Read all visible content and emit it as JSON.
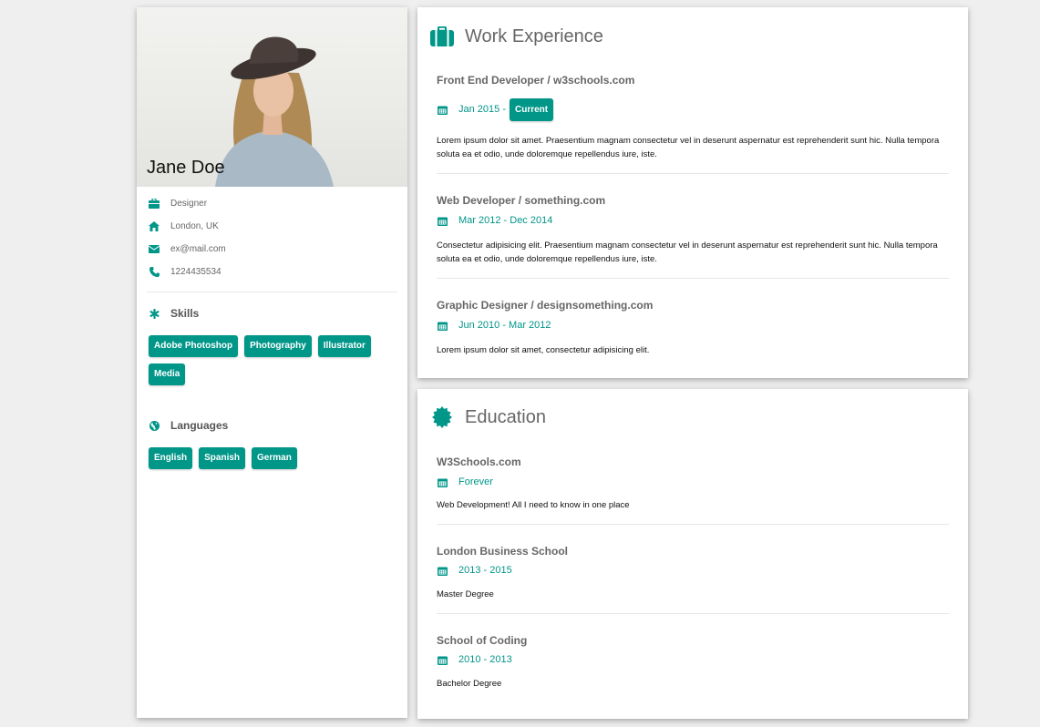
{
  "profile": {
    "name": "Jane Doe",
    "info": [
      {
        "icon": "briefcase-icon",
        "text": "Designer"
      },
      {
        "icon": "home-icon",
        "text": "London, UK"
      },
      {
        "icon": "envelope-icon",
        "text": "ex@mail.com"
      },
      {
        "icon": "phone-icon",
        "text": "1224435534"
      }
    ],
    "skills_label": "Skills",
    "skills": [
      "Adobe Photoshop",
      "Photography",
      "Illustrator",
      "Media"
    ],
    "languages_label": "Languages",
    "languages": [
      "English",
      "Spanish",
      "German"
    ]
  },
  "work": {
    "title": "Work Experience",
    "entries": [
      {
        "title": "Front End Developer / w3schools.com",
        "date": "Jan 2015 -",
        "badge": "Current",
        "desc": "Lorem ipsum dolor sit amet. Praesentium magnam consectetur vel in deserunt aspernatur est reprehenderit sunt hic. Nulla tempora soluta ea et odio, unde doloremque repellendus iure, iste."
      },
      {
        "title": "Web Developer / something.com",
        "date": "Mar 2012 - Dec 2014",
        "desc": "Consectetur adipisicing elit. Praesentium magnam consectetur vel in deserunt aspernatur est reprehenderit sunt hic. Nulla tempora soluta ea et odio, unde doloremque repellendus iure, iste."
      },
      {
        "title": "Graphic Designer / designsomething.com",
        "date": "Jun 2010 - Mar 2012",
        "desc": "Lorem ipsum dolor sit amet, consectetur adipisicing elit."
      }
    ]
  },
  "education": {
    "title": "Education",
    "entries": [
      {
        "title": "W3Schools.com",
        "date": "Forever",
        "desc": "Web Development! All I need to know in one place"
      },
      {
        "title": "London Business School",
        "date": "2013 - 2015",
        "desc": "Master Degree"
      },
      {
        "title": "School of Coding",
        "date": "2010 - 2013",
        "desc": "Bachelor Degree"
      }
    ]
  },
  "colors": {
    "accent": "#009688",
    "background": "#efefef"
  }
}
